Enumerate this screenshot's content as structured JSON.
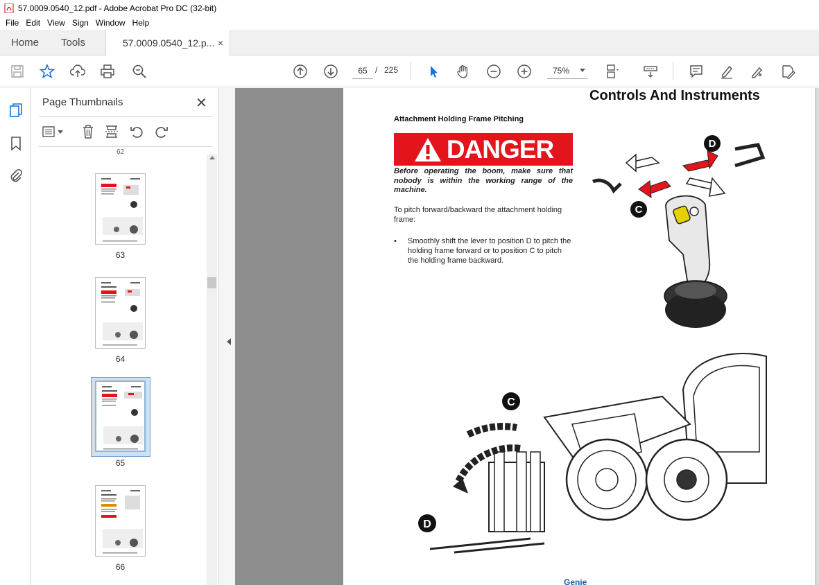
{
  "window": {
    "title": "57.0009.0540_12.pdf - Adobe Acrobat Pro DC (32-bit)"
  },
  "menu": [
    "File",
    "Edit",
    "View",
    "Sign",
    "Window",
    "Help"
  ],
  "tabs": {
    "home": "Home",
    "tools": "Tools",
    "document": "57.0009.0540_12.p...",
    "close": "×"
  },
  "toolbar": {
    "current_page": "65",
    "separator": "/",
    "total_pages": "225",
    "zoom": "75%"
  },
  "thumbnails": {
    "title": "Page Thumbnails",
    "close": "✕",
    "cut_label": "62",
    "items": [
      {
        "label": "63"
      },
      {
        "label": "64"
      },
      {
        "label": "65",
        "selected": true
      },
      {
        "label": "66"
      }
    ]
  },
  "document": {
    "heading": "Controls And Instruments",
    "section_title": "Attachment Holding Frame Pitching",
    "danger_word": "DANGER",
    "danger_text": "Before operating the boom, make sure that nobody is within the working range of the machine.",
    "intro": "To pitch forward/backward the attachment holding frame:",
    "bullet_symbol": "•",
    "bullet": "Smoothly shift the lever to position D to pitch the holding frame forward or to position C to pitch the holding frame backward.",
    "label_d": "D",
    "label_c": "C",
    "footer_brand": "Genie"
  },
  "colors": {
    "danger_red": "#e3141c",
    "accent_blue": "#1473e6",
    "viewport_gray": "#8e8e8e"
  }
}
